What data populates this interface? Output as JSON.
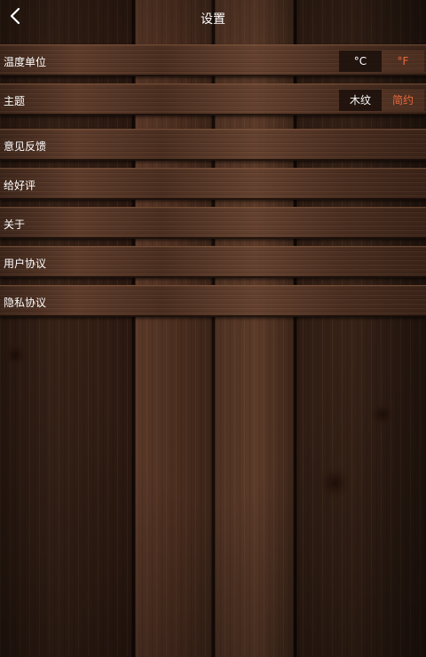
{
  "header": {
    "title": "设置",
    "back_icon": "chevron-left-icon"
  },
  "settings": {
    "temperature_unit": {
      "label": "温度单位",
      "options": [
        "°C",
        "°F"
      ],
      "selected": "°F"
    },
    "theme": {
      "label": "主题",
      "options": [
        "木纹",
        "简约"
      ],
      "selected": "简约"
    },
    "feedback": {
      "label": "意见反馈"
    },
    "rate": {
      "label": "给好评"
    },
    "about": {
      "label": "关于"
    },
    "user_agreement": {
      "label": "用户协议"
    },
    "privacy_policy": {
      "label": "隐私协议"
    }
  },
  "colors": {
    "accent": "#e86a3c",
    "text": "#ffffff",
    "segment_dark": "#1c100b"
  }
}
